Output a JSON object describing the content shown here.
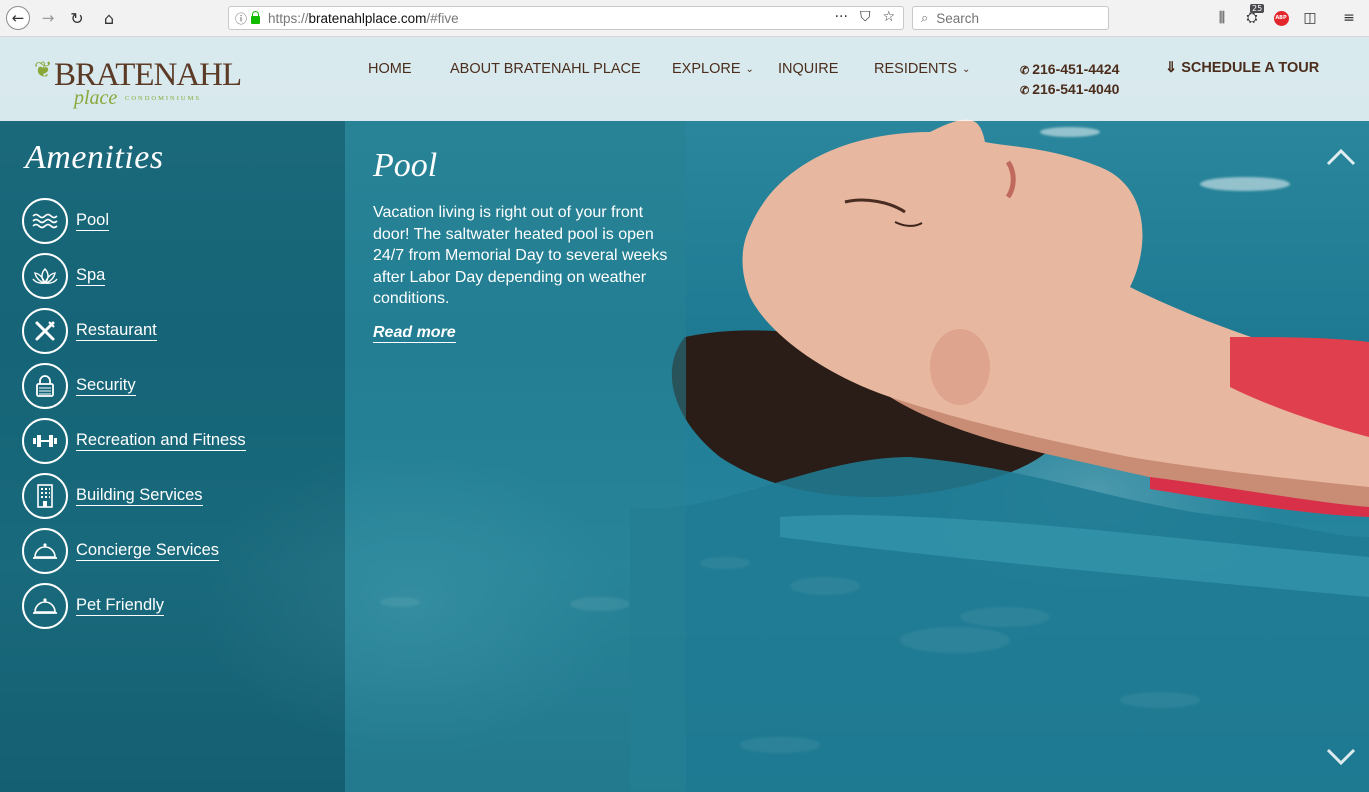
{
  "browser": {
    "url_prefix": "https://",
    "url_domain": "bratenahlplace.com",
    "url_rest": "/#five",
    "search_placeholder": "Search",
    "ext_badge": "25",
    "abp_label": "ABP",
    "icons": [
      "back-icon",
      "forward-icon",
      "reload-icon",
      "home-icon",
      "info-icon",
      "lock-icon",
      "more-icon",
      "pocket-icon",
      "bookmark-star-icon",
      "search-icon",
      "library-icon",
      "extension-icon",
      "adblock-icon",
      "sidebar-icon",
      "menu-icon"
    ]
  },
  "header": {
    "logo_main": "BRATENAHL",
    "logo_place": "place",
    "logo_condo": "CONDOMINIUMS",
    "nav": {
      "home": "HOME",
      "about": "ABOUT BRATENAHL PLACE",
      "explore": "EXPLORE",
      "inquire": "INQUIRE",
      "residents": "RESIDENTS"
    },
    "phone1": "216-451-4424",
    "phone2": "216-541-4040",
    "tour": "SCHEDULE A TOUR"
  },
  "amenities": {
    "title": "Amenities",
    "items": [
      {
        "label": "Pool",
        "icon": "waves-icon"
      },
      {
        "label": "Spa",
        "icon": "lotus-icon"
      },
      {
        "label": "Restaurant",
        "icon": "fork-knife-icon"
      },
      {
        "label": "Security",
        "icon": "padlock-icon"
      },
      {
        "label": "Recreation and Fitness",
        "icon": "dumbbell-icon"
      },
      {
        "label": "Building Services",
        "icon": "building-icon"
      },
      {
        "label": "Concierge Services",
        "icon": "service-bell-icon"
      },
      {
        "label": "Pet Friendly",
        "icon": "service-bell-icon"
      }
    ]
  },
  "detail": {
    "title": "Pool",
    "description": "Vacation living is right out of your front door! The saltwater heated pool is open 24/7 from Memorial Day to several weeks after Labor Day depending on weather conditions.",
    "read_more": "Read more"
  },
  "colors": {
    "brand_brown": "#4a2d1c",
    "brand_green": "#8aa83a",
    "water": "#1d7a92"
  }
}
